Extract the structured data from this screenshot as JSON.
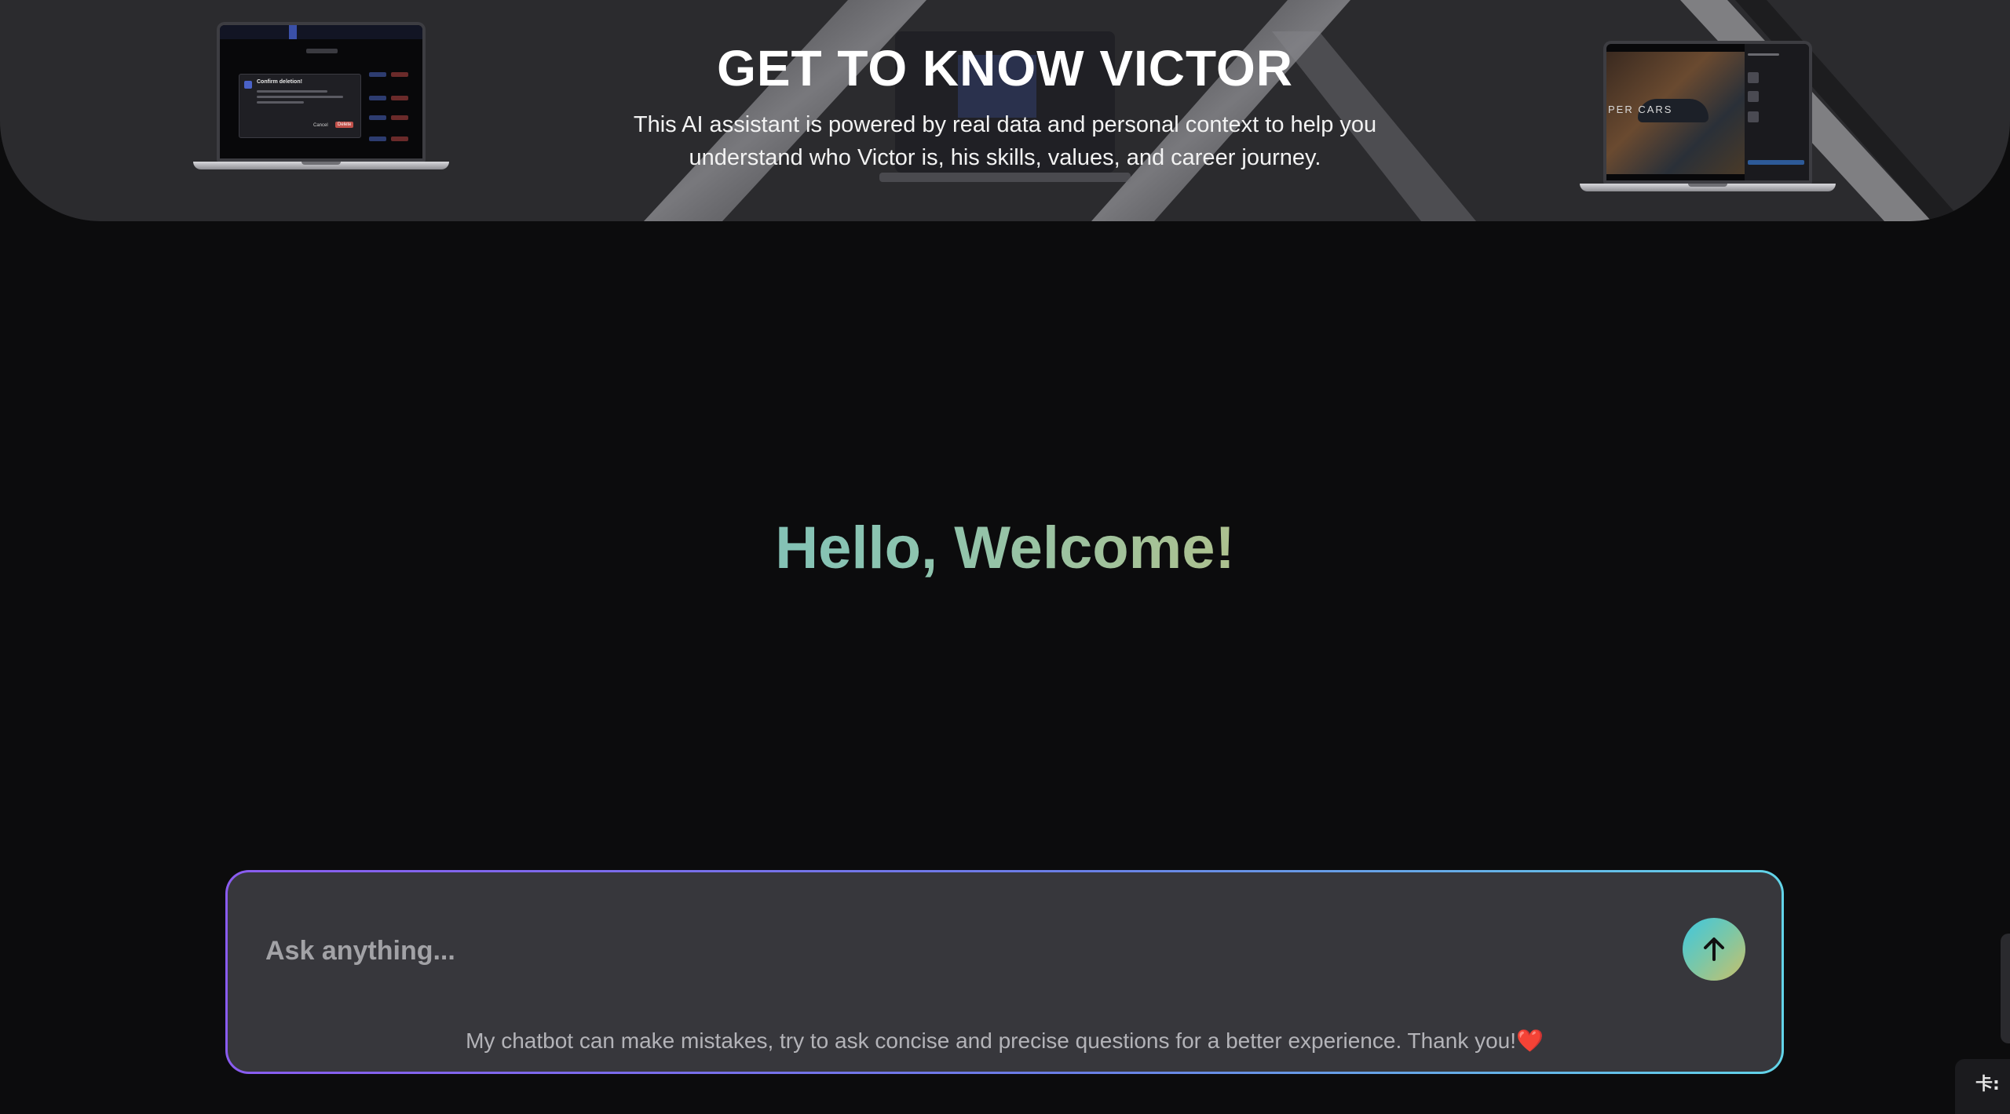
{
  "hero": {
    "title": "GET TO KNOW VICTOR",
    "subtitle": "This AI assistant is powered by real data and personal context to help you understand who Victor is, his skills, values, and career journey.",
    "left_laptop": {
      "dialog_title": "Confirm deletion!",
      "cancel_label": "Cancel",
      "delete_label": "Delete"
    },
    "right_laptop": {
      "screen_text": "PER CARS"
    }
  },
  "welcome": {
    "heading": "Hello, Welcome!"
  },
  "chat": {
    "placeholder": "Ask anything...",
    "value": "",
    "send_icon": "arrow-up-icon",
    "disclaimer": "My chatbot can make mistakes, try to ask concise and precise questions for a better experience. Thank you!",
    "disclaimer_emoji": "❤️"
  },
  "corner_widget": {
    "text": "卡:"
  },
  "colors": {
    "page_background": "#0c0c0d",
    "hero_background": "#2b2b2e",
    "chat_background": "#37373c",
    "gradient_start": "#4fb8d6",
    "gradient_end": "#d8b75a",
    "border_purple": "#8a5cf0",
    "border_cyan": "#62d4e8"
  }
}
